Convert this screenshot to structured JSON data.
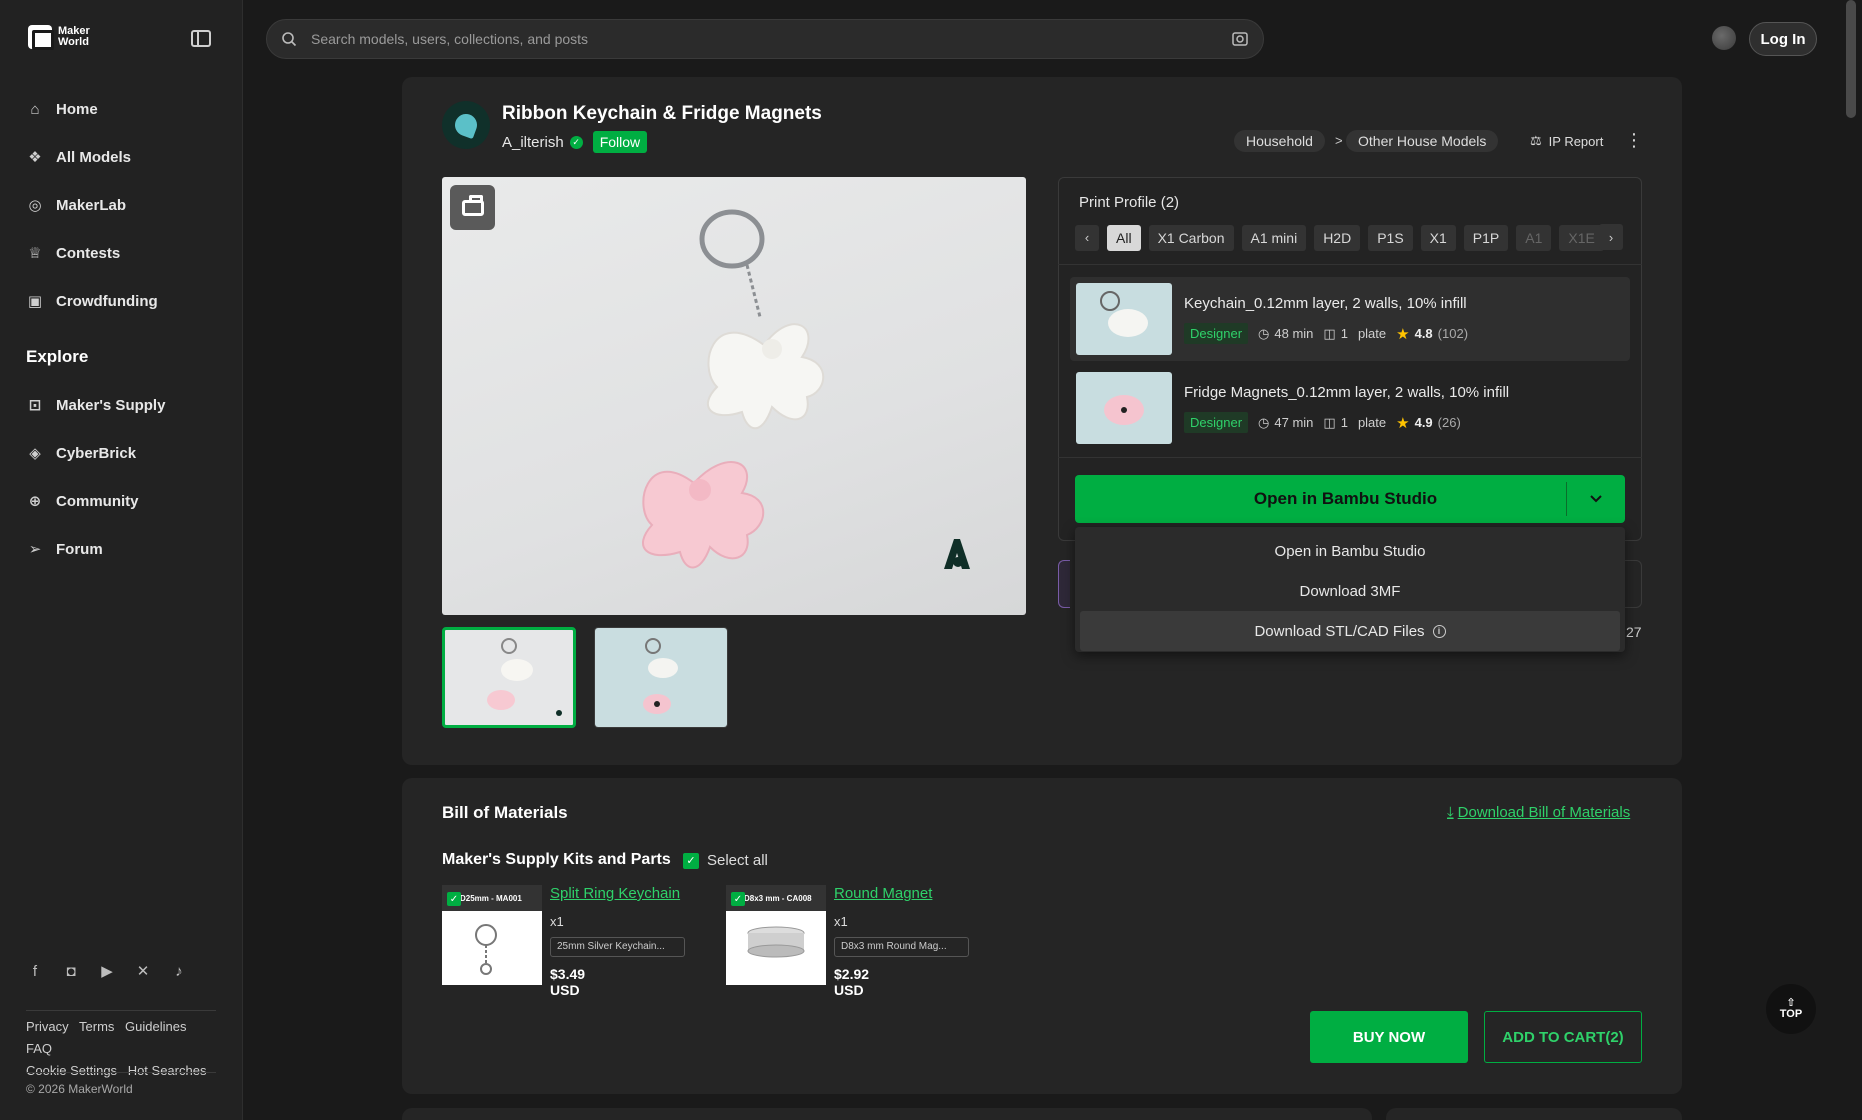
{
  "brand": {
    "logo_text": "Maker World"
  },
  "sidebar": {
    "items": [
      {
        "label": "Home",
        "icon": "home-icon"
      },
      {
        "label": "All Models",
        "icon": "models-icon"
      },
      {
        "label": "MakerLab",
        "icon": "makerlab-icon"
      },
      {
        "label": "Contests",
        "icon": "trophy-icon"
      },
      {
        "label": "Crowdfunding",
        "icon": "crowdfunding-icon"
      }
    ],
    "explore_heading": "Explore",
    "explore_items": [
      {
        "label": "Maker's Supply",
        "icon": "bag-icon"
      },
      {
        "label": "CyberBrick",
        "icon": "cyberbrick-icon"
      },
      {
        "label": "Community",
        "icon": "globe-icon"
      },
      {
        "label": "Forum",
        "icon": "send-icon"
      }
    ],
    "social": [
      "facebook-icon",
      "instagram-icon",
      "youtube-icon",
      "x-icon",
      "tiktok-icon"
    ],
    "footer_links": [
      "Privacy",
      "Terms",
      "Guidelines",
      "FAQ",
      "Cookie Settings",
      "Hot Searches"
    ],
    "copyright": "© 2026 MakerWorld"
  },
  "header": {
    "search_placeholder": "Search models, users, collections, and posts",
    "login_label": "Log In"
  },
  "model": {
    "title": "Ribbon Keychain & Fridge Magnets",
    "author": "A_ilterish",
    "follow_label": "Follow",
    "breadcrumb": [
      "Household",
      "Other House Models"
    ],
    "breadcrumb_sep": ">",
    "ip_report": "IP Report"
  },
  "print_profile": {
    "title": "Print Profile (2)",
    "filters": [
      "All",
      "X1 Carbon",
      "A1 mini",
      "H2D",
      "P1S",
      "X1",
      "P1P",
      "A1",
      "X1E"
    ],
    "profiles": [
      {
        "name": "Keychain_0.12mm layer, 2 walls, 10% infill",
        "badge": "Designer",
        "time": "48 min",
        "plates": "1",
        "plate_label": "plate",
        "rating": "4.8",
        "rating_count": "(102)"
      },
      {
        "name": "Fridge Magnets_0.12mm layer, 2 walls, 10% infill",
        "badge": "Designer",
        "time": "47 min",
        "plates": "1",
        "plate_label": "plate",
        "rating": "4.9",
        "rating_count": "(26)"
      }
    ],
    "open_button": "Open in Bambu Studio",
    "dropdown": [
      "Open in Bambu Studio",
      "Download 3MF",
      "Download STL/CAD Files"
    ],
    "hidden_count_fragment": "27"
  },
  "bom": {
    "title": "Bill of Materials",
    "download_label": "Download Bill of Materials",
    "kits_title": "Maker's Supply Kits and Parts",
    "select_all": "Select all",
    "kits": [
      {
        "img_label": "D25mm - MA001",
        "name": "Split Ring Keychain",
        "qty": "x1",
        "option": "25mm Silver Keychain...",
        "price": "$3.49 USD"
      },
      {
        "img_label": "D8x3 mm - CA008",
        "name": "Round Magnet",
        "qty": "x1",
        "option": "D8x3 mm Round Mag...",
        "price": "$2.92 USD"
      }
    ],
    "buy_now": "BUY NOW",
    "add_to_cart": "ADD TO CART(2)"
  },
  "top_button": "TOP",
  "colors": {
    "accent": "#00ae42",
    "background": "#1a1a1a",
    "panel": "#252525"
  }
}
